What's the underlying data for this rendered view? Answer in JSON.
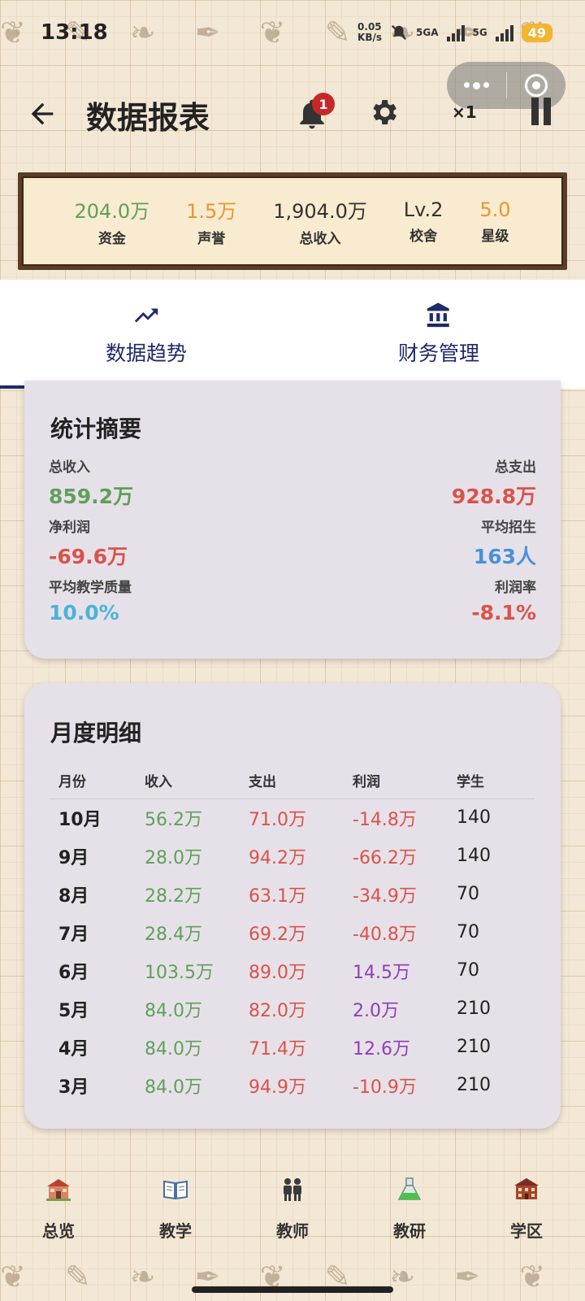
{
  "status_bar": {
    "time": "13:18",
    "net_speed_value": "0.05",
    "net_speed_unit": "KB/s",
    "network1": "5GA",
    "network2": "5G",
    "battery": "49"
  },
  "header": {
    "title": "数据报表",
    "notification_count": "1",
    "speed": "×1"
  },
  "resources": [
    {
      "value": "204.0万",
      "label": "资金",
      "color": "#5fa05a"
    },
    {
      "value": "1.5万",
      "label": "声誉",
      "color": "#e8962e"
    },
    {
      "value": "1,904.0万",
      "label": "总收入",
      "color": "#333333"
    },
    {
      "value": "Lv.2",
      "label": "校舍",
      "color": "#333333"
    },
    {
      "value": "5.0",
      "label": "星级",
      "color": "#e8962e"
    }
  ],
  "tabs": [
    {
      "label": "数据趋势",
      "icon": "trending-up-icon",
      "active": true
    },
    {
      "label": "财务管理",
      "icon": "bank-icon",
      "active": false
    }
  ],
  "summary": {
    "title": "统计摘要",
    "total_income": {
      "label": "总收入",
      "value": "859.2万",
      "color": "#5fa05a"
    },
    "total_expense": {
      "label": "总支出",
      "value": "928.8万",
      "color": "#d9534a"
    },
    "net_profit": {
      "label": "净利润",
      "value": "-69.6万",
      "color": "#d9534a"
    },
    "avg_enrollment": {
      "label": "平均招生",
      "value": "163人",
      "color": "#4a90d9"
    },
    "avg_quality": {
      "label": "平均教学质量",
      "value": "10.0%",
      "color": "#4ab3d9"
    },
    "profit_rate": {
      "label": "利润率",
      "value": "-8.1%",
      "color": "#d9534a"
    }
  },
  "monthly": {
    "title": "月度明细",
    "headers": [
      "月份",
      "收入",
      "支出",
      "利润",
      "学生"
    ],
    "rows": [
      {
        "month": "10月",
        "income": "56.2万",
        "expense": "71.0万",
        "profit": "-14.8万",
        "students": "140"
      },
      {
        "month": "9月",
        "income": "28.0万",
        "expense": "94.2万",
        "profit": "-66.2万",
        "students": "140"
      },
      {
        "month": "8月",
        "income": "28.2万",
        "expense": "63.1万",
        "profit": "-34.9万",
        "students": "70"
      },
      {
        "month": "7月",
        "income": "28.4万",
        "expense": "69.2万",
        "profit": "-40.8万",
        "students": "70"
      },
      {
        "month": "6月",
        "income": "103.5万",
        "expense": "89.0万",
        "profit": "14.5万",
        "students": "70"
      },
      {
        "month": "5月",
        "income": "84.0万",
        "expense": "82.0万",
        "profit": "2.0万",
        "students": "210"
      },
      {
        "month": "4月",
        "income": "84.0万",
        "expense": "71.4万",
        "profit": "12.6万",
        "students": "210"
      },
      {
        "month": "3月",
        "income": "84.0万",
        "expense": "94.9万",
        "profit": "-10.9万",
        "students": "210"
      }
    ],
    "colors": {
      "income": "#5fa05a",
      "expense": "#d9534a",
      "loss": "#d9534a",
      "gain": "#8e3fb8"
    }
  },
  "bottom_nav": [
    {
      "label": "总览",
      "icon": "school-building-icon"
    },
    {
      "label": "教学",
      "icon": "open-book-icon"
    },
    {
      "label": "教师",
      "icon": "teachers-icon"
    },
    {
      "label": "教研",
      "icon": "flask-icon"
    },
    {
      "label": "学区",
      "icon": "campus-icon"
    }
  ]
}
